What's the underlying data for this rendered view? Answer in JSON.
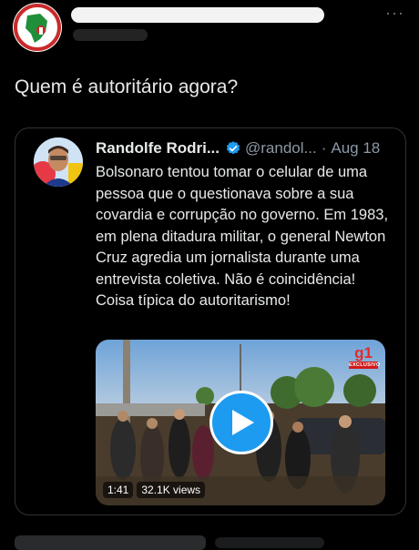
{
  "tweet": {
    "text": "Quem é autoritário agora?",
    "more_label": "···"
  },
  "quote": {
    "author_name": "Randolfe Rodri...",
    "handle": "@randol...",
    "separator": "·",
    "date": "Aug 18",
    "verified_icon": "verified-badge-icon",
    "text": "Bolsonaro tentou tomar o celular de uma pessoa que o questionava sobre a sua covardia e corrupção no governo. Em 1983, em plena ditadura militar, o general Newton Cruz agredia um jornalista durante uma entrevista coletiva. Não é coincidência! Coisa típica do autoritarismo!",
    "video": {
      "duration": "1:41",
      "views": "32.1K views",
      "channel_logo": "g1",
      "badge": "EXCLUSIVO",
      "play_icon": "play-icon"
    }
  },
  "colors": {
    "background": "#000000",
    "text": "#e7e9ea",
    "secondary": "#8b98a5",
    "accent": "#1d9bf0",
    "card_border": "#2f3336"
  }
}
